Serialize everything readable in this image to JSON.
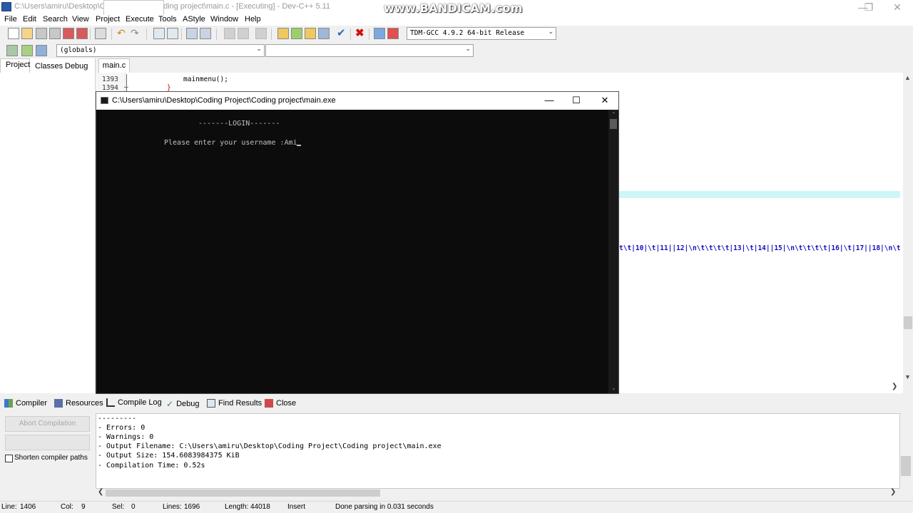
{
  "window": {
    "title": "C:\\Users\\amiru\\Desktop\\Coding Project\\Coding project\\main.c - [Executing] - Dev-C++ 5.11",
    "watermark": "www.BANDICAM.com"
  },
  "menu": [
    "File",
    "Edit",
    "Search",
    "View",
    "Project",
    "Execute",
    "Tools",
    "AStyle",
    "Window",
    "Help"
  ],
  "toolbar": {
    "compiler_select": "TDM-GCC 4.9.2 64-bit Release",
    "scope_select": "(globals)",
    "member_select": ""
  },
  "left_tabs": [
    "Project",
    "Classes",
    "Debug"
  ],
  "editor": {
    "file_tab": "main.c",
    "lines": [
      {
        "num": "1393",
        "fold": "",
        "code": "mainmenu();"
      },
      {
        "num": "1394",
        "fold": "–",
        "code": "}"
      }
    ],
    "visible_fragment": "t\\t|10|\\t|11||12|\\n\\t\\t\\t\\t|13|\\t|14||15|\\n\\t\\t\\t\\t|16|\\t|17||18|\\n\\t"
  },
  "console": {
    "title": "C:\\Users\\amiru\\Desktop\\Coding Project\\Coding project\\main.exe",
    "heading": "-------LOGIN-------",
    "prompt": "Please enter your username :Ami"
  },
  "bottom_tabs": [
    "Compiler",
    "Resources",
    "Compile Log",
    "Debug",
    "Find Results",
    "Close"
  ],
  "bottom_left": {
    "abort_button": "Abort Compilation",
    "checkbox_label": "Shorten compiler paths"
  },
  "log": [
    "---------",
    "- Errors: 0",
    "- Warnings: 0",
    "- Output Filename: C:\\Users\\amiru\\Desktop\\Coding Project\\Coding project\\main.exe",
    "- Output Size: 154.6083984375 KiB",
    "- Compilation Time: 0.52s"
  ],
  "status": {
    "line_label": "Line:",
    "line_value": "1406",
    "col_label": "Col:",
    "col_value": "9",
    "sel_label": "Sel:",
    "sel_value": "0",
    "lines_label": "Lines:",
    "lines_value": "1696",
    "length_label": "Length:",
    "length_value": "44018",
    "mode": "Insert",
    "message": "Done parsing in 0.031 seconds"
  },
  "colors": {
    "console_bg": "#0c0c0c",
    "code_red": "#c00000",
    "code_blue": "#1010c0",
    "highlight_line": "#cdf6f6"
  }
}
